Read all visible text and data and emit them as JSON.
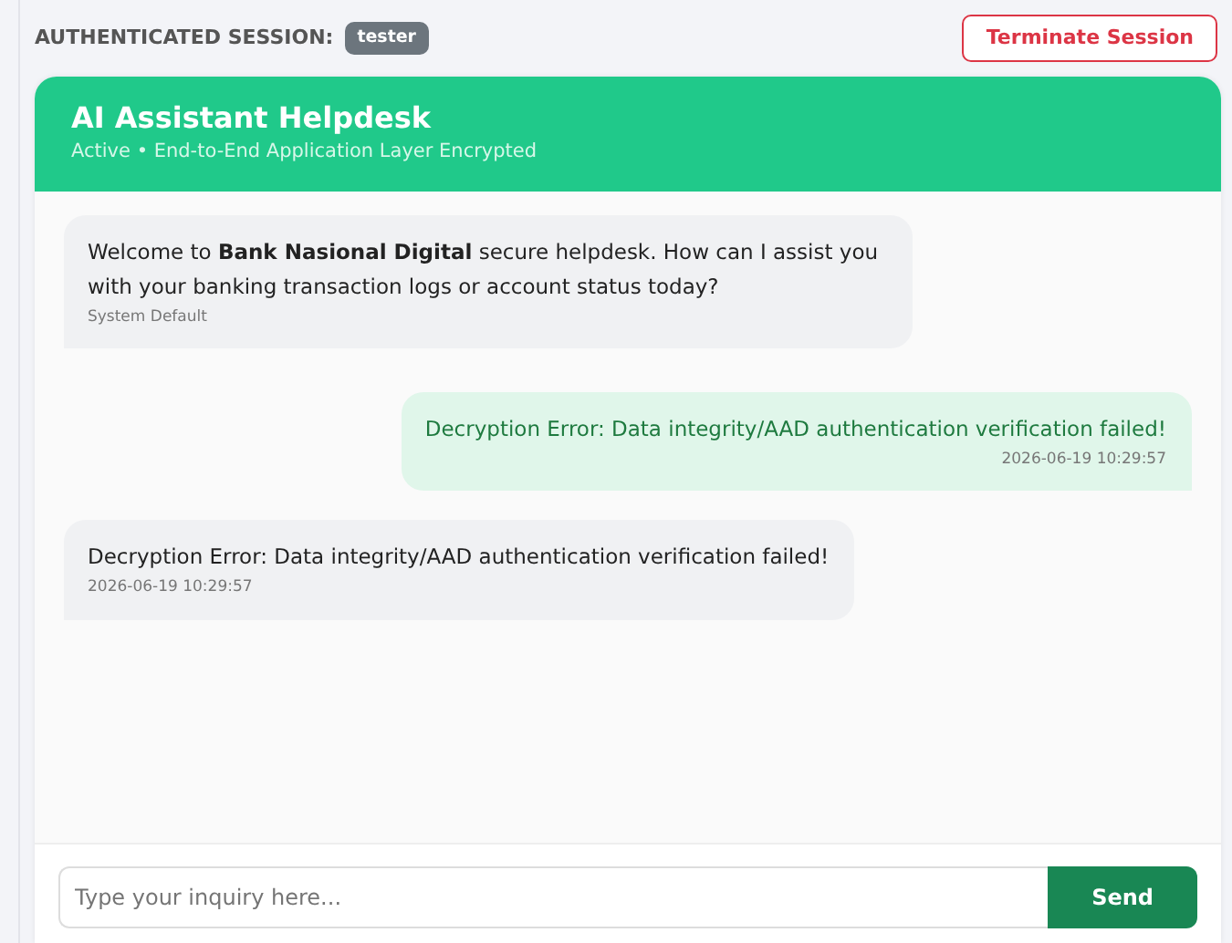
{
  "session": {
    "label": "AUTHENTICATED SESSION:",
    "user": "tester",
    "terminate_button": "Terminate Session"
  },
  "chat": {
    "title": "AI Assistant Helpdesk",
    "subtitle": "Active • End-to-End Application Layer Encrypted",
    "messages": [
      {
        "kind": "bot",
        "text": "Welcome to **Bank Nasional Digital** secure helpdesk. How can I assist you with your banking transaction logs or account status today?",
        "meta": "System Default"
      },
      {
        "kind": "user",
        "text": "Decryption Error: Data integrity/AAD authentication verification failed!",
        "meta": "2026-06-19 10:29:57"
      },
      {
        "kind": "bot",
        "text": "Decryption Error: Data integrity/AAD authentication verification failed!",
        "meta": "2026-06-19 10:29:57"
      }
    ],
    "input": {
      "placeholder": "Type your inquiry here..."
    },
    "send_button": "Send"
  }
}
